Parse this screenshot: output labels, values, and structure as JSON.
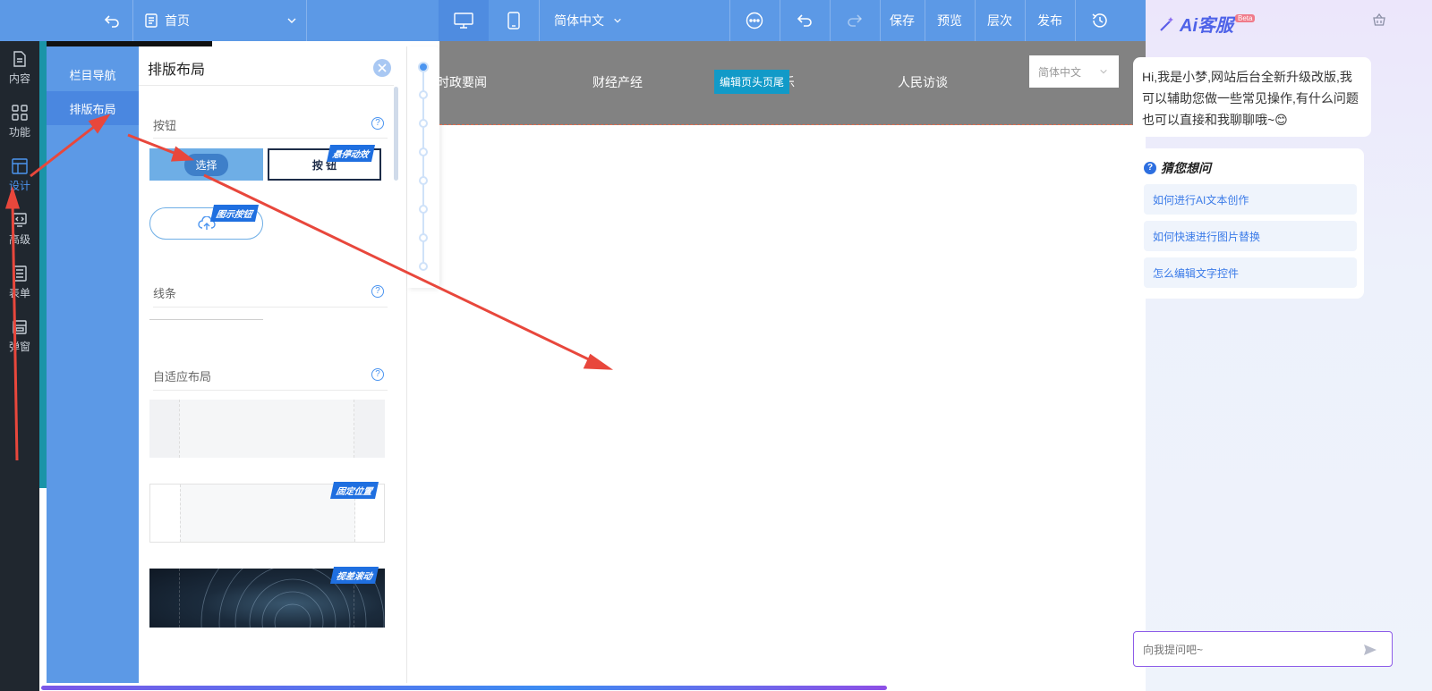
{
  "topbar": {
    "page_name": "首页",
    "language": "简体中文",
    "save": "保存",
    "preview": "预览",
    "layers": "层次",
    "publish": "发布"
  },
  "rail": {
    "items": [
      {
        "label": "内容",
        "icon": "document-icon"
      },
      {
        "label": "功能",
        "icon": "grid-icon"
      },
      {
        "label": "设计",
        "icon": "layout-icon"
      },
      {
        "label": "高级",
        "icon": "monitor-icon"
      },
      {
        "label": "表单",
        "icon": "form-icon"
      },
      {
        "label": "弹窗",
        "icon": "popup-icon"
      }
    ]
  },
  "subnav": {
    "items": [
      "栏目导航",
      "排版布局"
    ]
  },
  "library": {
    "title": "排版布局",
    "sections": {
      "button": "按钮",
      "line": "线条",
      "adaptive": "自适应布局"
    },
    "select_label": "选择",
    "button_sample": "按 钮",
    "tags": {
      "hover": "悬停动效",
      "icon_button": "图示按钮",
      "fixed": "固定位置",
      "parallax": "视差滚动"
    }
  },
  "site_header": {
    "nav": [
      "时政要闻",
      "财经产经",
      "娱乐",
      "人民访谈"
    ],
    "edit_badge": "编辑页头页尾",
    "language": "简体中文"
  },
  "ai": {
    "title": "Ai客服",
    "beta": "Beta",
    "greeting": "Hi,我是小梦,网站后台全新升级改版,我可以辅助您做一些常见操作,有什么问题也可以直接和我聊聊哦~😊",
    "guess_title": "猜您想问",
    "questions": [
      "如何进行AI文本创作",
      "如何快速进行图片替换",
      "怎么编辑文字控件"
    ],
    "input_placeholder": "向我提问吧~"
  },
  "colors": {
    "topbar": "#5c99e6",
    "rail": "#20272f",
    "accent": "#4c95f0",
    "arrow": "#e8473c"
  }
}
